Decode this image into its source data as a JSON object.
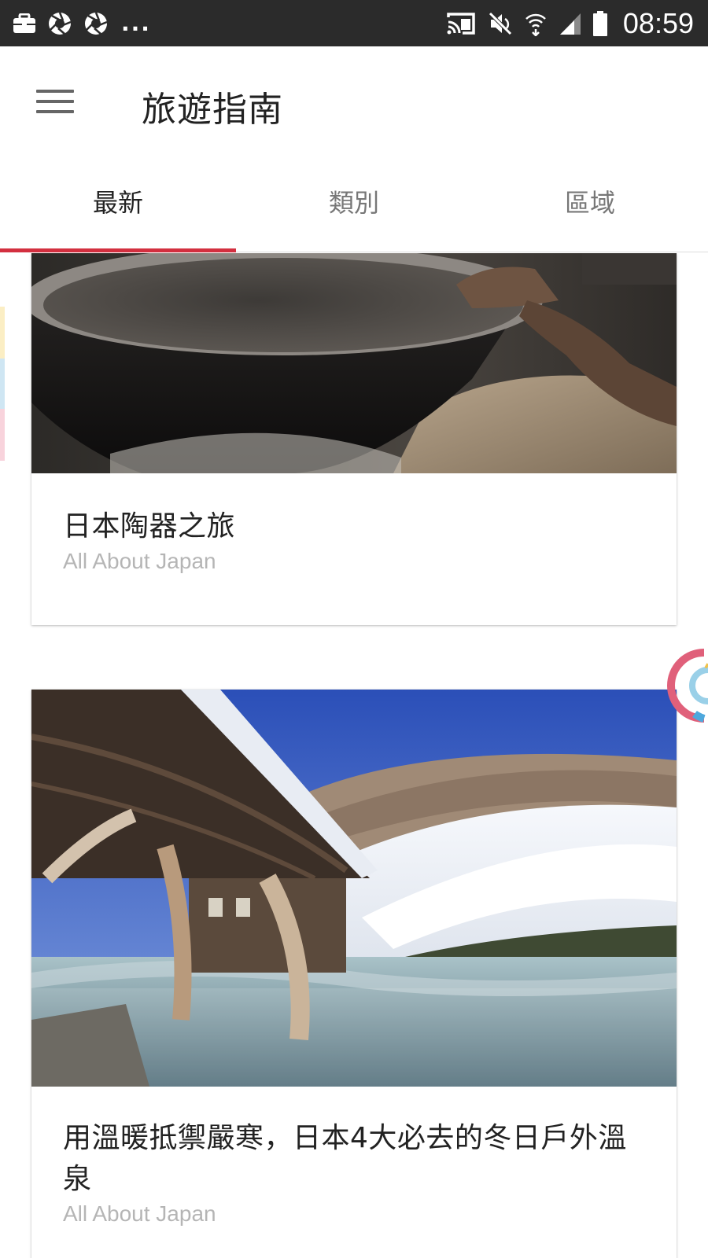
{
  "status_bar": {
    "left_icons": [
      "briefcase-icon",
      "camera-aperture-icon",
      "camera-aperture-icon"
    ],
    "overflow_text": "...",
    "right_icons": [
      "cast-icon",
      "mute-icon",
      "wifi-icon",
      "signal-icon",
      "battery-icon"
    ],
    "time": "08:59"
  },
  "app_bar": {
    "menu_icon": "hamburger-menu-icon",
    "title": "旅遊指南"
  },
  "tabs": [
    {
      "label": "最新",
      "active": true
    },
    {
      "label": "類別",
      "active": false
    },
    {
      "label": "區域",
      "active": false
    }
  ],
  "accent_color": "#d32f3f",
  "articles": [
    {
      "title": "日本陶器之旅",
      "source": "All About Japan",
      "image": "pottery-bowl-photo"
    },
    {
      "title": "用溫暖抵禦嚴寒，日本4大必去的冬日戶外溫泉",
      "source": "All About Japan",
      "image": "snowy-hot-spring-photo"
    }
  ]
}
